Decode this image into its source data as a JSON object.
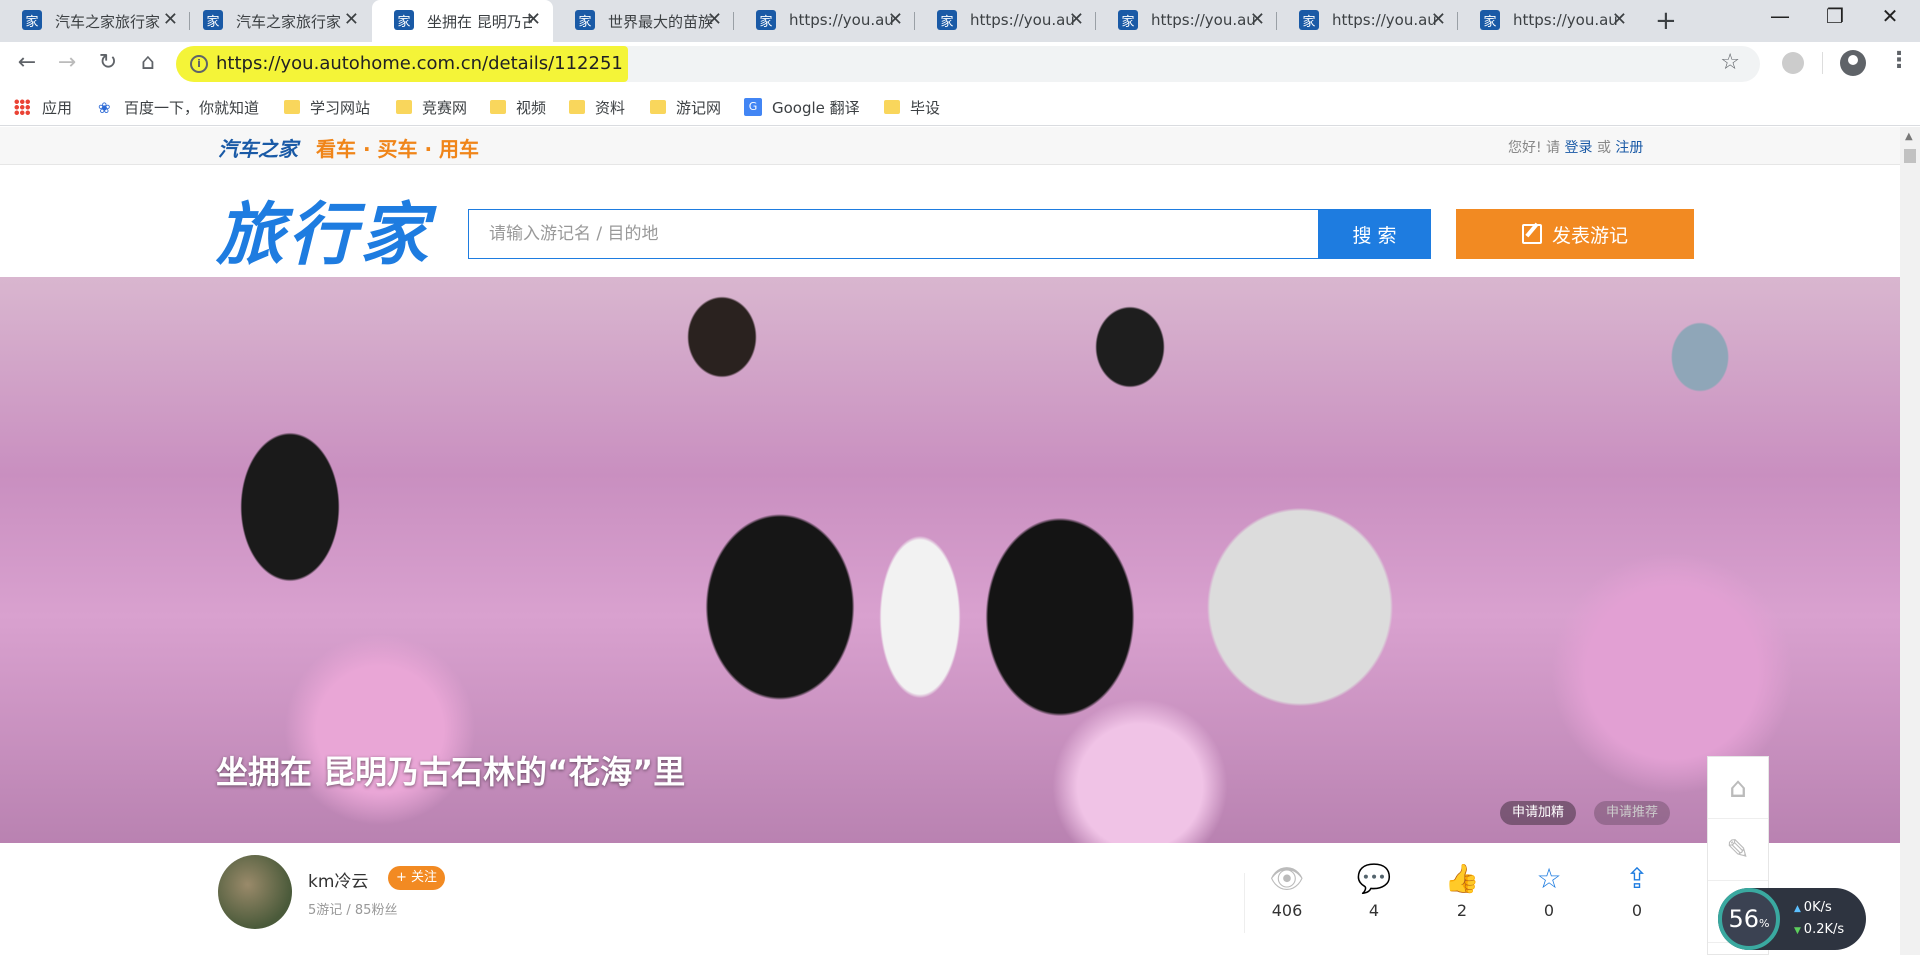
{
  "browser": {
    "tabs": [
      {
        "title": "汽车之家旅行家",
        "active": false
      },
      {
        "title": "汽车之家旅行家",
        "active": false
      },
      {
        "title": "坐拥在 昆明乃古",
        "active": true
      },
      {
        "title": "世界最大的苗族",
        "active": false
      },
      {
        "title": "https://you.au",
        "active": false
      },
      {
        "title": "https://you.au",
        "active": false
      },
      {
        "title": "https://you.au",
        "active": false
      },
      {
        "title": "https://you.au",
        "active": false
      },
      {
        "title": "https://you.au",
        "active": false
      }
    ],
    "tab_favicon": "家",
    "url": "https://you.autohome.com.cn/details/112251",
    "bookmarks": [
      {
        "label": "应用",
        "icon": "apps-grid-icon"
      },
      {
        "label": "百度一下，你就知道",
        "icon": "baidu-paw-icon"
      },
      {
        "label": "学习网站",
        "icon": "folder-icon"
      },
      {
        "label": "竞赛网",
        "icon": "folder-icon"
      },
      {
        "label": "视频",
        "icon": "folder-icon"
      },
      {
        "label": "资料",
        "icon": "folder-icon"
      },
      {
        "label": "游记网",
        "icon": "folder-icon"
      },
      {
        "label": "Google 翻译",
        "icon": "google-translate-icon"
      },
      {
        "label": "毕设",
        "icon": "folder-icon"
      }
    ]
  },
  "site": {
    "logo": "汽车之家",
    "slogan": "看车 · 买车 · 用车",
    "greeting": "您好! 请",
    "login": "登录",
    "or": "或",
    "register": "注册",
    "brand": "旅行家",
    "search_placeholder": "请输入游记名 / 目的地",
    "search_button": "搜 索",
    "post_button": "发表游记"
  },
  "hero": {
    "title": "坐拥在 昆明乃古石林的“花海”里",
    "apply_featured": "申请加精",
    "apply_recommend": "申请推荐"
  },
  "author": {
    "name": "km冷云",
    "follow": "+ 关注",
    "stats": "5游记 / 85粉丝"
  },
  "stats": {
    "views": "406",
    "comments": "4",
    "likes": "2",
    "favorites": "0",
    "shares": "0"
  },
  "speed_widget": {
    "percent": "56",
    "percent_unit": "%",
    "upload": "0K/s",
    "download": "0.2K/s"
  },
  "colors": {
    "brand_blue": "#1e7ce0",
    "accent_orange": "#f28a22",
    "url_highlight": "#f4f438"
  }
}
